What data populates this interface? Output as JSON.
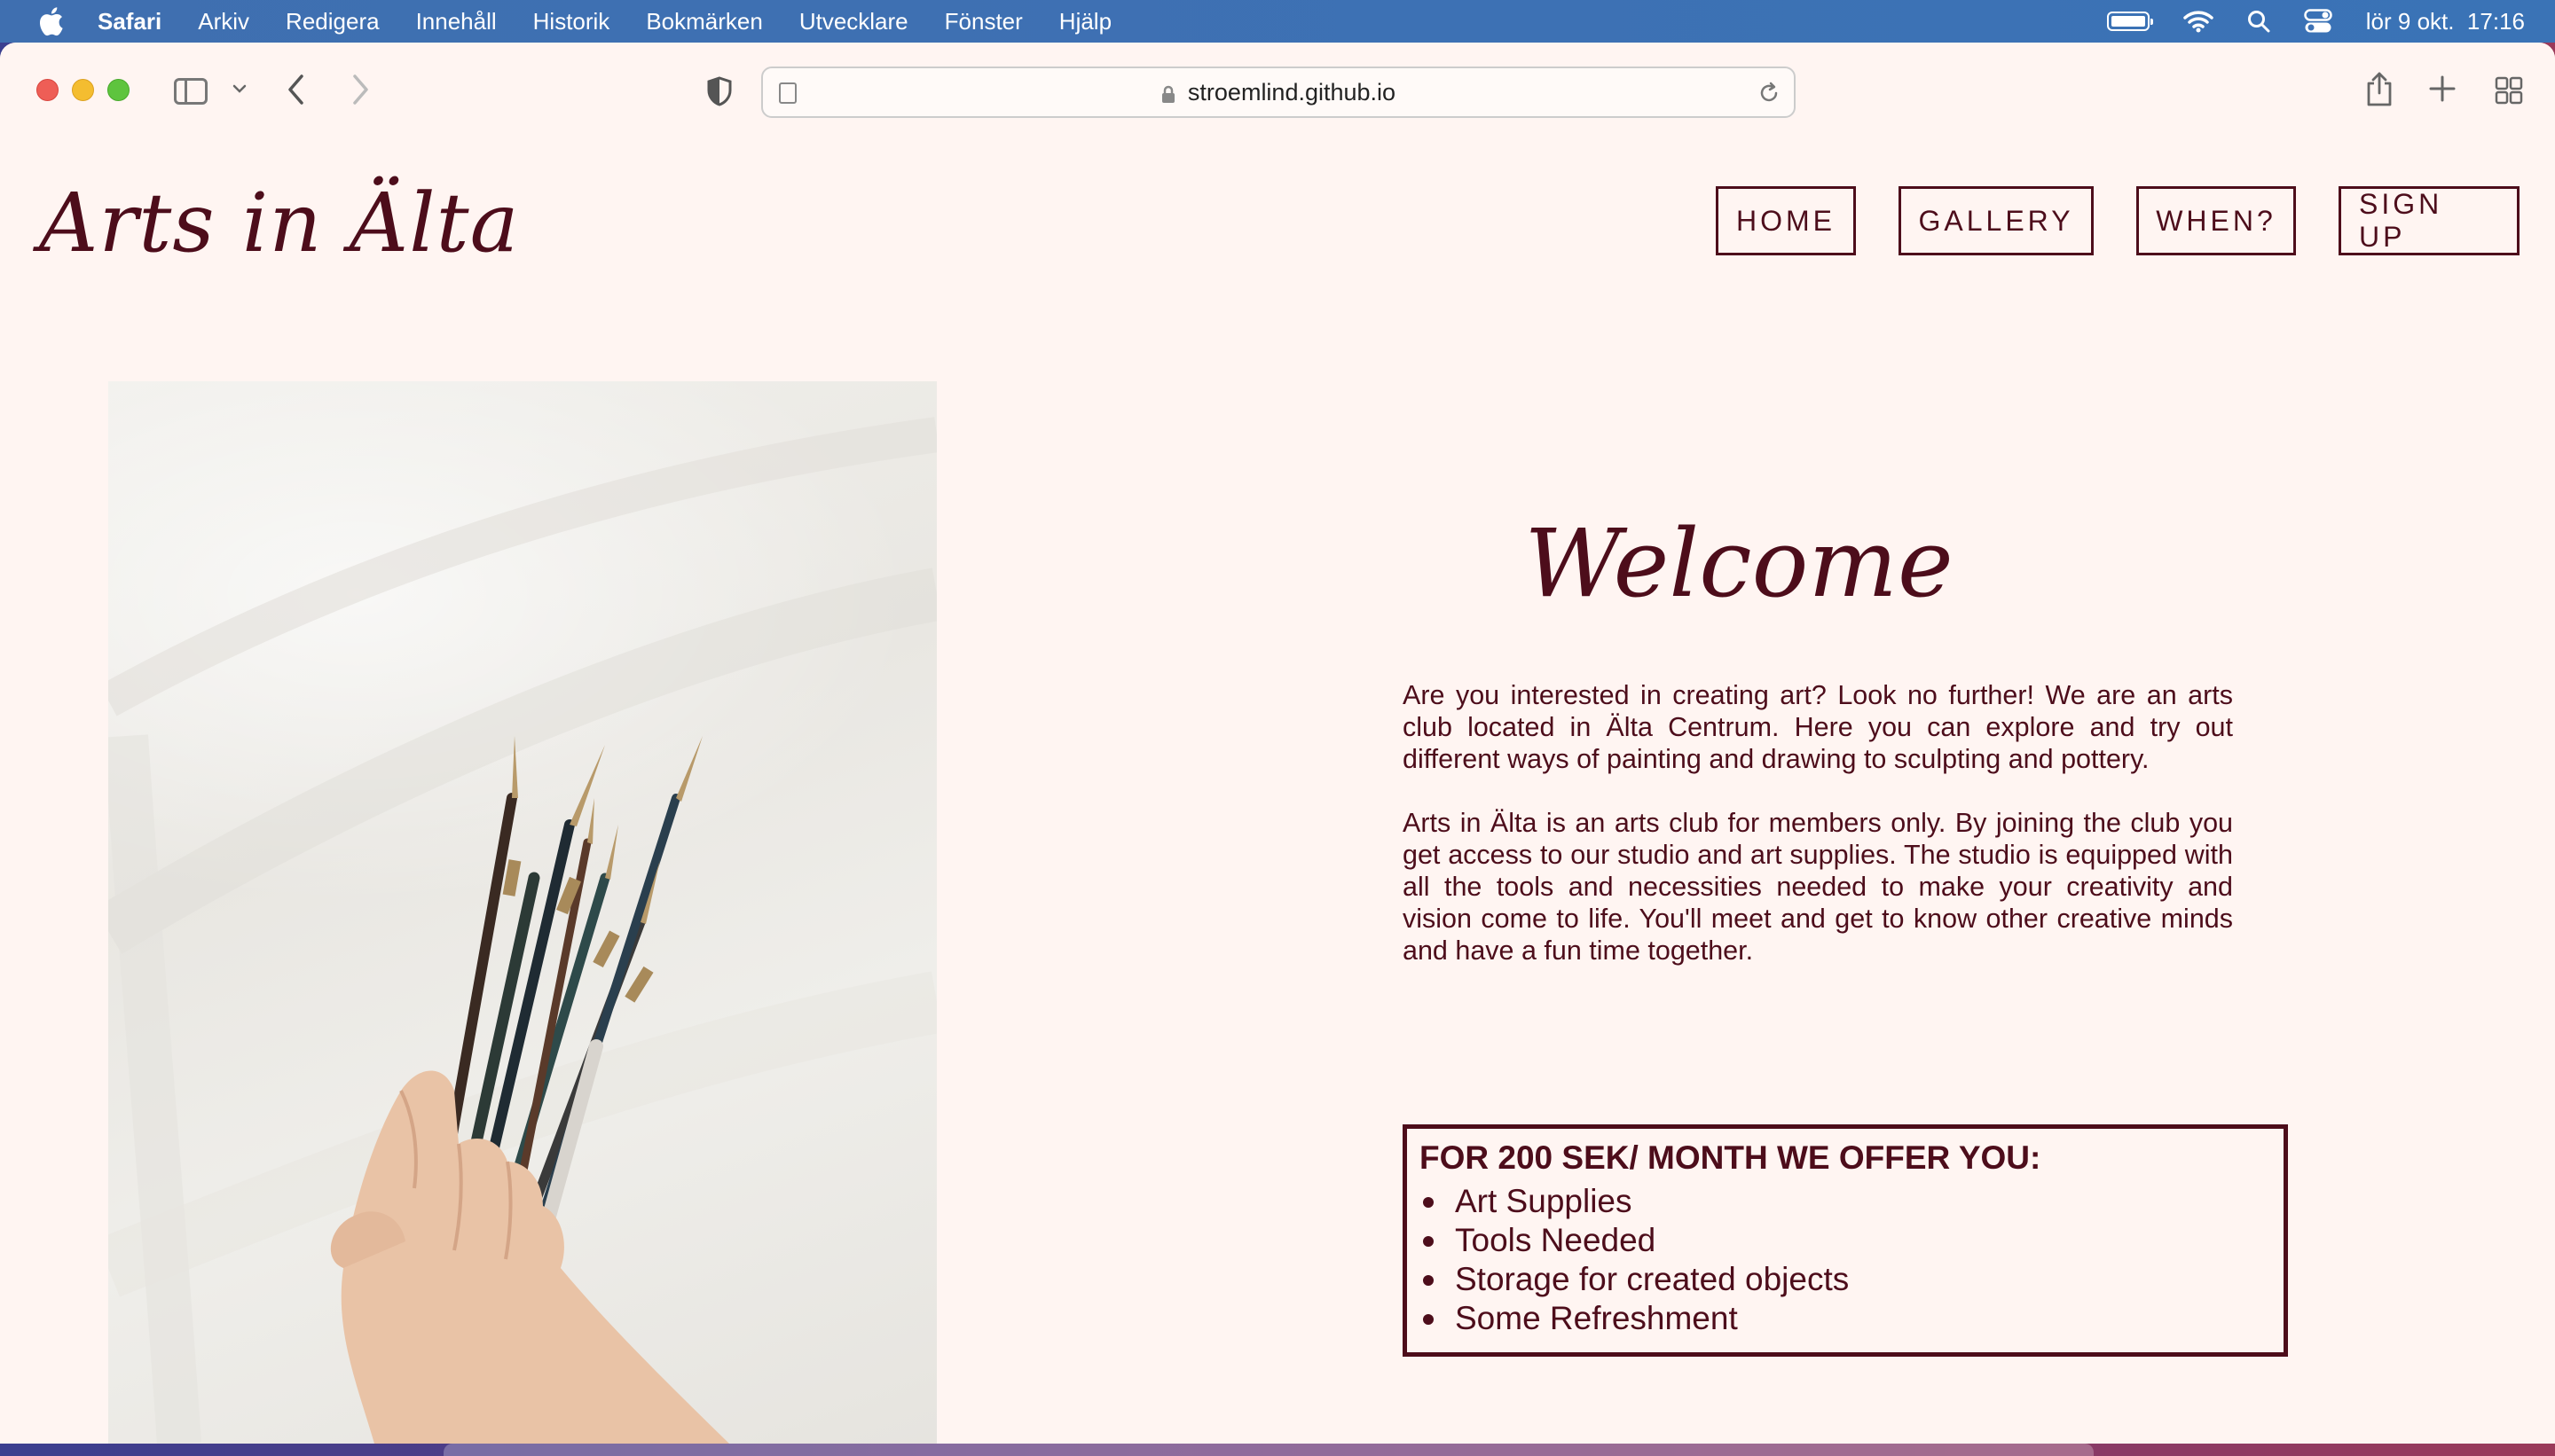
{
  "menubar": {
    "app": "Safari",
    "items": [
      "Arkiv",
      "Redigera",
      "Innehåll",
      "Historik",
      "Bokmärken",
      "Utvecklare",
      "Fönster",
      "Hjälp"
    ],
    "clock": "lör 9 okt.  17:16"
  },
  "browser": {
    "url": "stroemlind.github.io"
  },
  "site": {
    "title": "Arts in Älta",
    "nav": {
      "home": "HOME",
      "gallery": "GALLERY",
      "when": "WHEN?",
      "signup": "SIGN UP"
    },
    "welcome": "Welcome",
    "intro": "Are you interested in creating art? Look no further! We are an arts club located in Älta Centrum. Here you can explore and try out different ways of painting and drawing to sculpting and pottery.",
    "membership": "Arts in Älta is an arts club for members only. By joining the club you get access to our studio and art supplies. The studio is equipped with all the tools and necessities needed to make your creativity and vision come to life. You'll meet and get to know other creative minds and have a fun time together.",
    "offer": {
      "heading": "FOR 200 SEK/ MONTH WE OFFER YOU:",
      "items": [
        "Art Supplies",
        "Tools Needed",
        "Storage for created objects",
        "Some Refreshment"
      ]
    }
  },
  "colors": {
    "brand": "#4d0d1b",
    "page_bg": "#fff5f2",
    "menubar_bg": "#3d71b4"
  }
}
